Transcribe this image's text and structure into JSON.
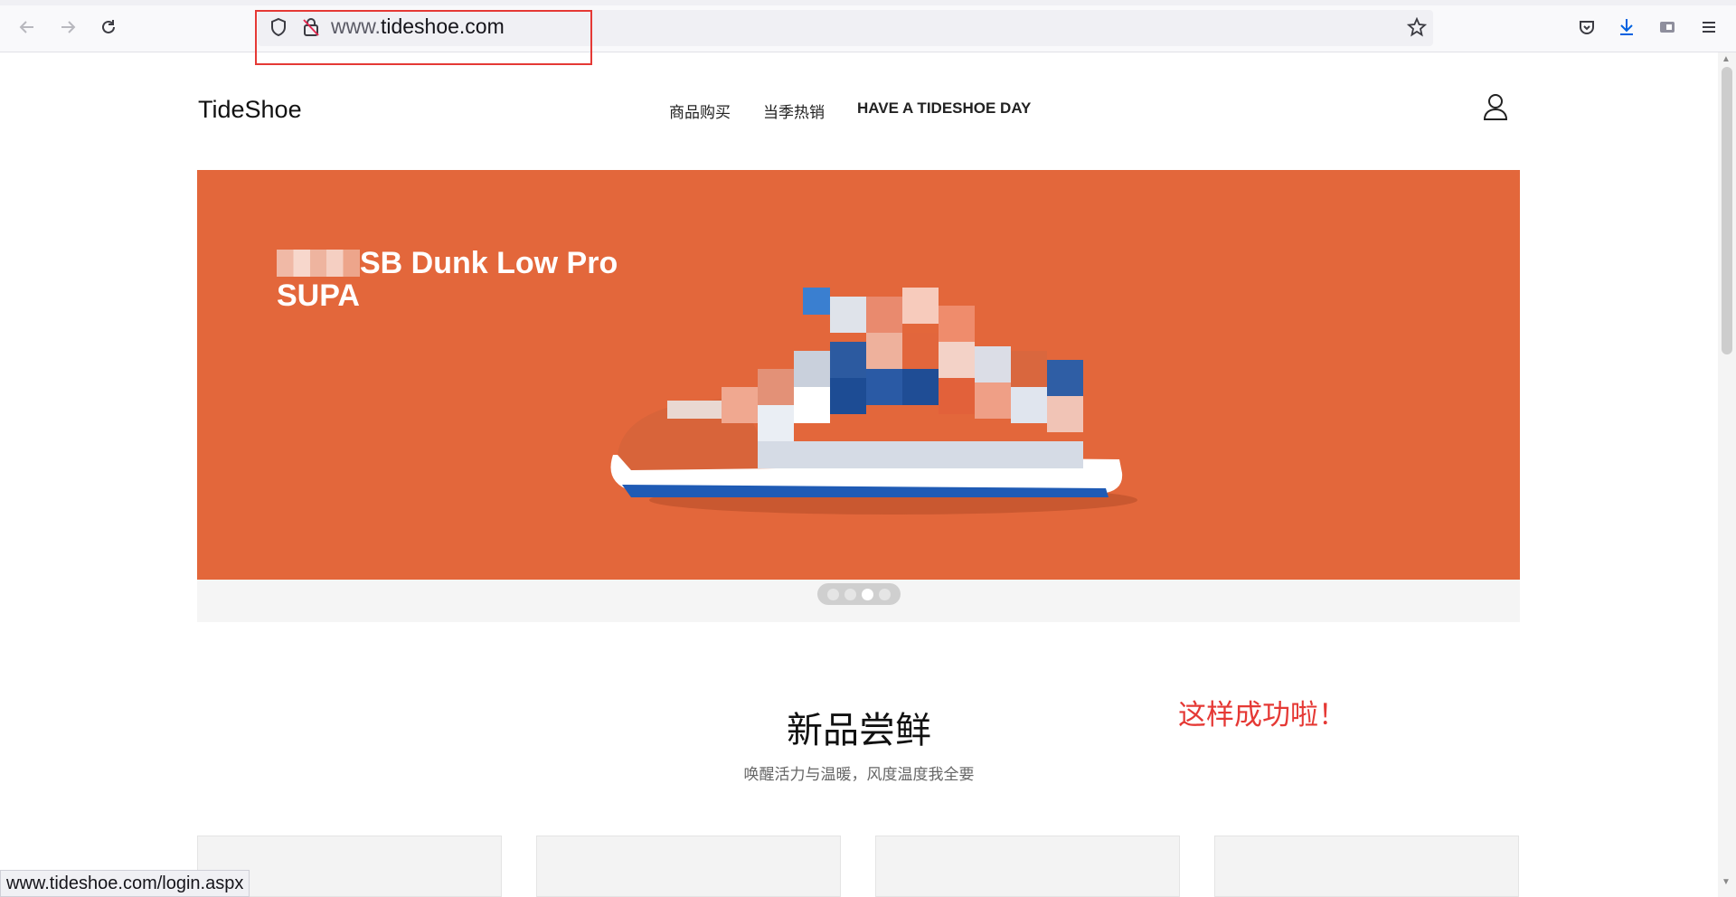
{
  "browser": {
    "url_prefix": "www.",
    "url_domain": "tideshoe.com",
    "status_url": "www.tideshoe.com/login.aspx",
    "icons": [
      "back-icon",
      "forward-icon",
      "reload-icon",
      "shield-icon",
      "insecure-lock-icon",
      "bookmark-star-icon",
      "pocket-icon",
      "download-icon",
      "extension-icon",
      "menu-icon"
    ]
  },
  "site": {
    "logo": "TideShoe",
    "nav": [
      "商品购买",
      "当季热销",
      "HAVE A TIDESHOE DAY"
    ],
    "hero": {
      "title_line1": "SB Dunk Low Pro",
      "title_line2": "SUPA",
      "bg_color": "#e3673b"
    },
    "carousel": {
      "count": 4,
      "active_index": 2
    },
    "section": {
      "title": "新品尝鲜",
      "subtitle": "唤醒活力与温暖，风度温度我全要"
    },
    "annotation": "这样成功啦！"
  }
}
